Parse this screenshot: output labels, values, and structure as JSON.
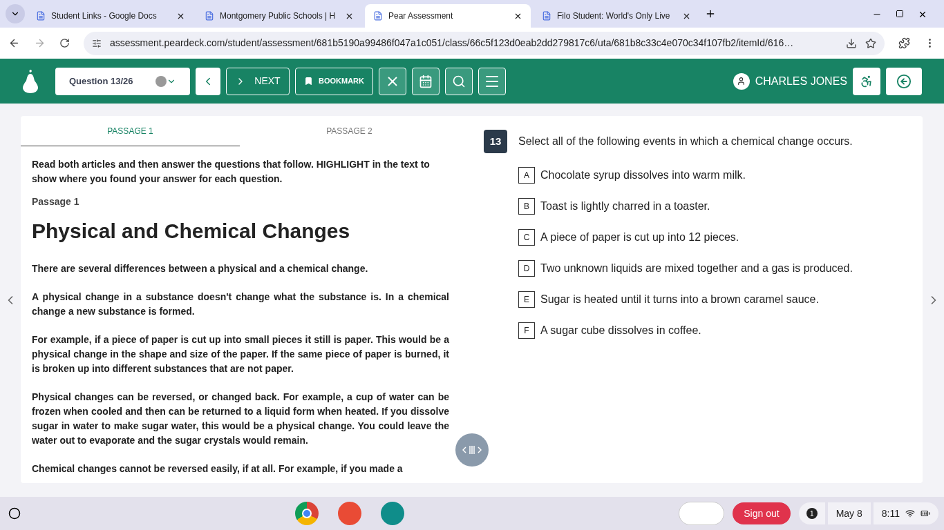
{
  "browser_tabs": [
    {
      "title": "Student Links - Google Docs",
      "selected": false
    },
    {
      "title": "Montgomery Public Schools | H",
      "selected": false
    },
    {
      "title": "Pear Assessment",
      "selected": true
    },
    {
      "title": "Filo Student: World's Only Live",
      "selected": false
    }
  ],
  "address": "assessment.peardeck.com/student/assessment/681b5190a99486f047a1c051/class/66c5f123d0eab2dd279817c6/uta/681b8c33c4e070c34f107fb2/itemId/616…",
  "toolbar": {
    "question": "Question 13/26",
    "next": "NEXT",
    "bookmark": "BOOKMARK",
    "user": "CHARLES JONES"
  },
  "passage_tabs": [
    {
      "label": "PASSAGE 1",
      "selected": true
    },
    {
      "label": "PASSAGE 2",
      "selected": false
    }
  ],
  "passage": {
    "instructions": "Read both articles and then answer the questions that follow.  HIGHLIGHT in the text to show where you found your answer for each question.",
    "label": "Passage 1",
    "title": "Physical and Chemical Changes",
    "paragraphs": [
      "There are several differences between a physical and a chemical change.",
      "A physical change in a substance doesn't change what the substance is. In a chemical change a new substance is formed.",
      "For example, if a piece of paper is cut up into small pieces it still is paper. This would be a physical change in the shape and size of the paper. If the same piece of paper is burned, it is broken up into different substances that are not paper.",
      "Physical changes can be reversed, or changed back.  For example, a cup of water can be frozen when cooled and then can be returned to a liquid form when heated.  If you dissolve sugar in water to make sugar water, this would be a physical change.  You could leave the water out to evaporate and the sugar crystals would remain.",
      "Chemical changes cannot be reversed easily, if at all.  For example, if you made a"
    ]
  },
  "question": {
    "number": "13",
    "prompt": "Select all of the following events in which a chemical change occurs.",
    "options": [
      {
        "letter": "A",
        "text": "Chocolate syrup dissolves into warm milk.",
        "selected": false
      },
      {
        "letter": "B",
        "text": "Toast is lightly charred in a toaster.",
        "selected": false
      },
      {
        "letter": "C",
        "text": "A piece of paper is cut up into 12 pieces.",
        "selected": false
      },
      {
        "letter": "D",
        "text": "Two unknown liquids are mixed together and a gas is produced.",
        "selected": false
      },
      {
        "letter": "E",
        "text": "Sugar is heated until it turns into a brown caramel sauce.",
        "selected": false
      },
      {
        "letter": "F",
        "text": "A sugar cube dissolves in coffee.",
        "selected": false
      }
    ]
  },
  "taskbar": {
    "sign_out": "Sign out",
    "notifications": "1",
    "date": "May 8",
    "time": "8:11"
  }
}
